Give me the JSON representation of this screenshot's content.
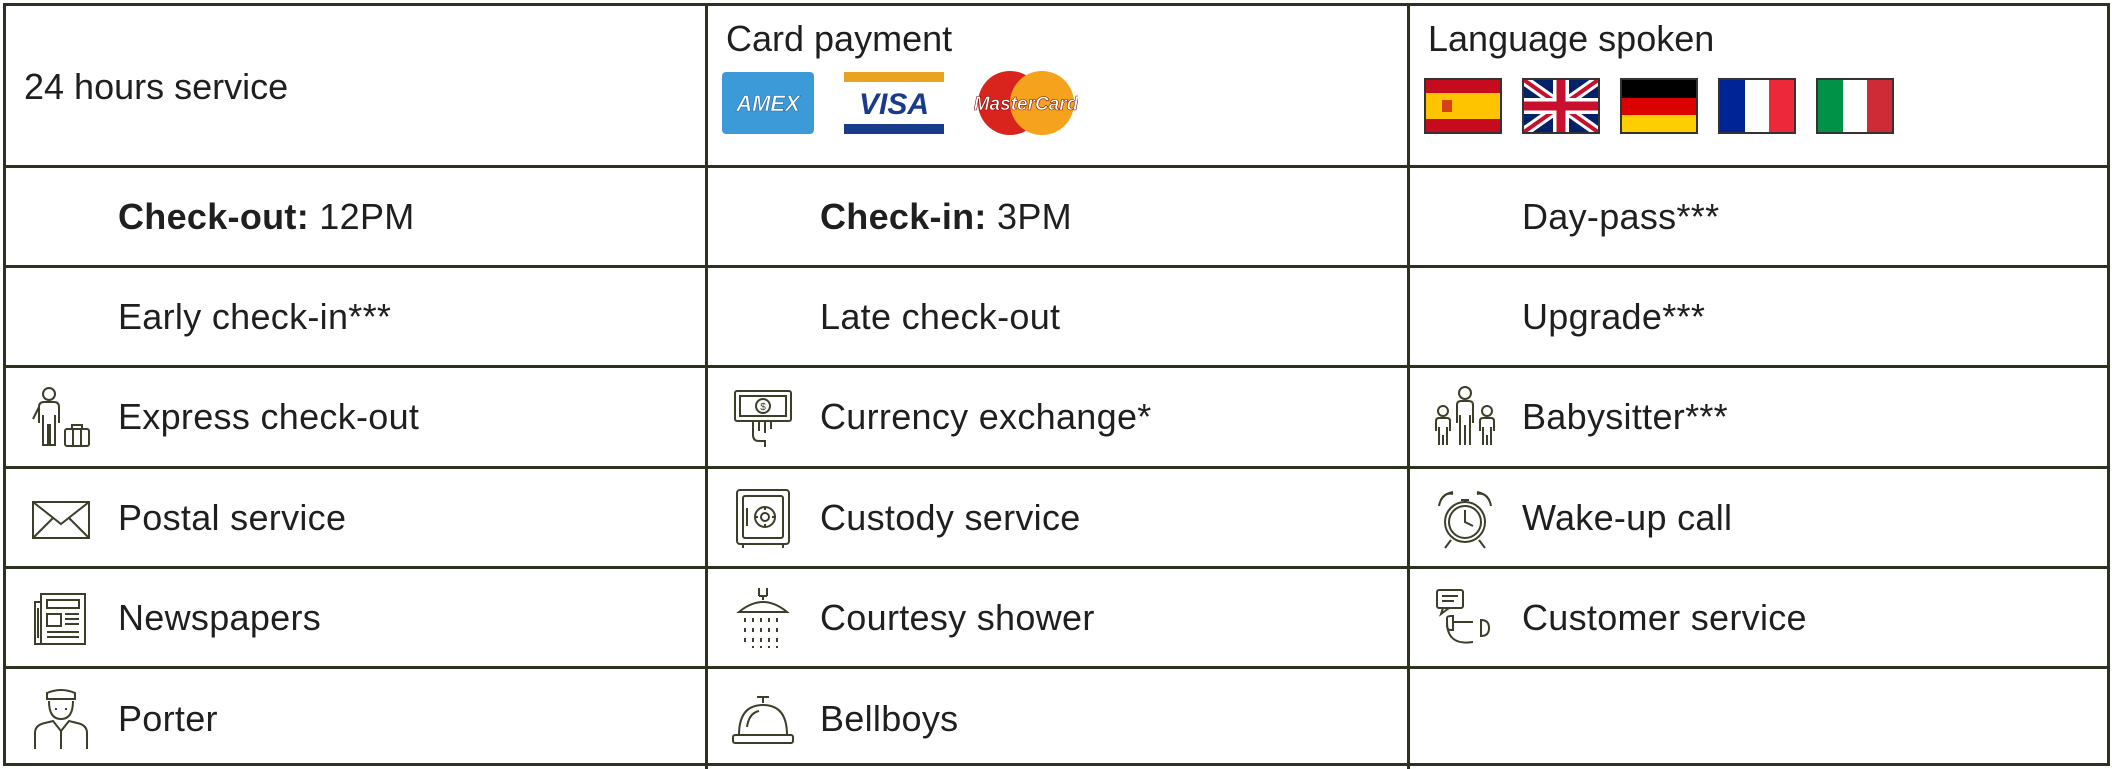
{
  "header": {
    "service24": "24 hours service",
    "card_payment": "Card payment",
    "languages": "Language spoken",
    "cards": [
      {
        "name": "amex-logo",
        "text": "AMEX"
      },
      {
        "name": "visa-logo",
        "text": "VISA"
      },
      {
        "name": "mastercard-logo",
        "text": "MasterCard"
      }
    ]
  },
  "rows": {
    "checkout_bold": "Check-out:",
    "checkout_time": " 12PM",
    "checkin_bold": "Check-in:",
    "checkin_time": " 3PM",
    "daypass": "Day-pass***",
    "early_checkin": "Early check-in***",
    "late_checkout": "Late check-out",
    "upgrade": "Upgrade***",
    "express_checkout": "Express check-out",
    "currency_exchange": "Currency exchange*",
    "babysitter": "Babysitter***",
    "postal": "Postal service",
    "custody": "Custody service",
    "wakeup": "Wake-up call",
    "newspapers": "Newspapers",
    "shower": "Courtesy shower",
    "customer_service": "Customer service",
    "porter": "Porter",
    "bellboys": "Bellboys"
  },
  "colors": {
    "border": "#2b3320",
    "icon_stroke": "#3a3f2a"
  }
}
